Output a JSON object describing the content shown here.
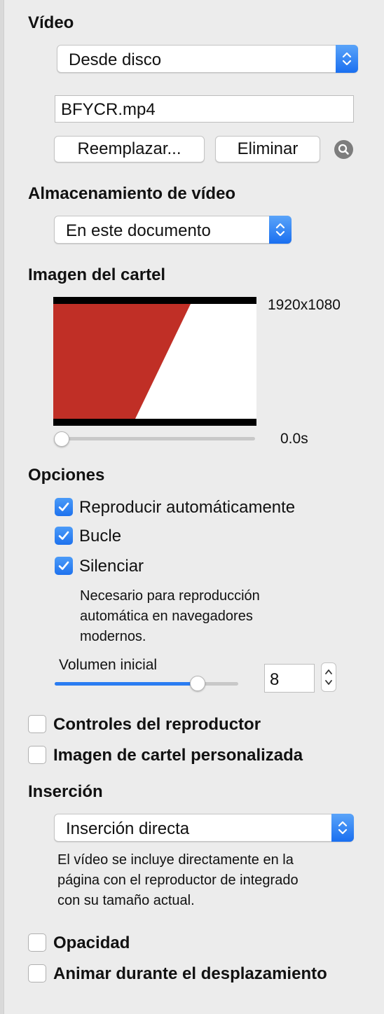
{
  "video": {
    "heading": "Vídeo",
    "source_select": "Desde disco",
    "filename": "BFYCR.mp4",
    "replace_button": "Reemplazar...",
    "delete_button": "Eliminar"
  },
  "storage": {
    "heading": "Almacenamiento de vídeo",
    "select": "En este documento"
  },
  "poster": {
    "heading": "Imagen del cartel",
    "dimensions": "1920x1080",
    "time": "0.0s",
    "time_slider_fraction": 0.0
  },
  "options": {
    "heading": "Opciones",
    "autoplay_label": "Reproducir automáticamente",
    "autoplay_checked": true,
    "loop_label": "Bucle",
    "loop_checked": true,
    "mute_label": "Silenciar",
    "mute_checked": true,
    "mute_note_lines": [
      "Necesario para reproducción",
      "automática en navegadores",
      "modernos."
    ],
    "volume_label": "Volumen inicial",
    "volume_value": "8",
    "volume_fraction": 0.78
  },
  "player_controls_label": "Controles del reproductor",
  "custom_poster_label": "Imagen de cartel personalizada",
  "insertion": {
    "heading": "Inserción",
    "select": "Inserción directa",
    "note_lines": [
      "El vídeo se incluye directamente en la",
      "página con el reproductor de integrado",
      "con su tamaño actual."
    ]
  },
  "opacity_label": "Opacidad",
  "animate_scroll_label": "Animar durante el desplazamiento",
  "colors": {
    "accent": "#1a6ff0",
    "poster_red": "#c02f26"
  }
}
